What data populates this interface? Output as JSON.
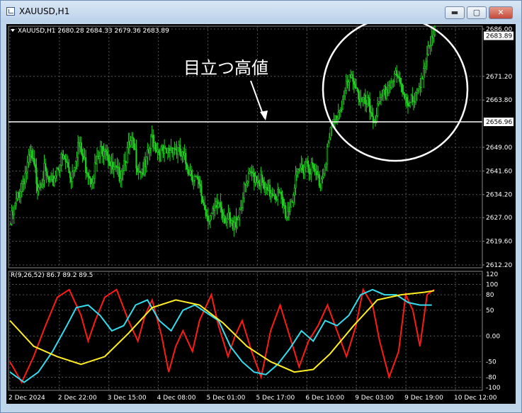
{
  "window": {
    "title": "XAUUSD,H1",
    "controls": {
      "minimize": "▬",
      "maximize": "▢",
      "close": "✕"
    },
    "colors": {
      "frame": "#bfd5ea",
      "chart_bg": "#000000",
      "candles": "#22cc22",
      "grid": "#555555",
      "axis_text": "#ffffff"
    }
  },
  "chart_data": [
    {
      "type": "candlestick",
      "symbol_info": "XAUUSD,H1  2680.28 2684.33 2679.36 2683.89",
      "annotation": "目立つ高値",
      "horizontal_line": {
        "value": 2656.96,
        "label": "2656.96",
        "color": "#ffffff"
      },
      "last_price": {
        "value": 2683.89,
        "label": "2683.89"
      },
      "y_ticks": [
        {
          "label": "2686.00",
          "value": 2686.0
        },
        {
          "label": "2671.20",
          "value": 2671.2
        },
        {
          "label": "2663.80",
          "value": 2663.8
        },
        {
          "label": "2649.00",
          "value": 2649.0
        },
        {
          "label": "2641.60",
          "value": 2641.6
        },
        {
          "label": "2634.20",
          "value": 2634.2
        },
        {
          "label": "2627.00",
          "value": 2627.0
        },
        {
          "label": "2619.60",
          "value": 2619.6
        },
        {
          "label": "2612.20",
          "value": 2612.2
        }
      ],
      "ylim": [
        2612.2,
        2686.0
      ],
      "x_ticks": [
        "2 Dec 2024",
        "2 Dec 22:00",
        "3 Dec 15:00",
        "4 Dec 08:00",
        "5 Dec 01:00",
        "5 Dec 17:00",
        "6 Dec 10:00",
        "9 Dec 03:00",
        "9 Dec 19:00",
        "10 Dec 12:00"
      ],
      "close_path": [
        [
          0,
          2625
        ],
        [
          6,
          2633
        ],
        [
          12,
          2640
        ],
        [
          18,
          2646
        ],
        [
          24,
          2638
        ],
        [
          30,
          2641
        ],
        [
          36,
          2636
        ],
        [
          42,
          2644
        ],
        [
          48,
          2645
        ],
        [
          54,
          2640
        ],
        [
          60,
          2650
        ],
        [
          66,
          2644
        ],
        [
          72,
          2640
        ],
        [
          78,
          2645
        ],
        [
          84,
          2651
        ],
        [
          90,
          2642
        ],
        [
          96,
          2640
        ],
        [
          102,
          2646
        ],
        [
          108,
          2650
        ],
        [
          114,
          2643
        ],
        [
          120,
          2642
        ],
        [
          126,
          2652
        ],
        [
          132,
          2648
        ],
        [
          138,
          2646
        ],
        [
          144,
          2650
        ],
        [
          150,
          2647
        ],
        [
          156,
          2644
        ],
        [
          162,
          2641
        ],
        [
          168,
          2636
        ],
        [
          174,
          2629
        ],
        [
          180,
          2627
        ],
        [
          186,
          2632
        ],
        [
          192,
          2627
        ],
        [
          198,
          2623
        ],
        [
          204,
          2630
        ],
        [
          210,
          2637
        ],
        [
          216,
          2641
        ],
        [
          222,
          2639
        ],
        [
          228,
          2634
        ],
        [
          234,
          2636
        ],
        [
          240,
          2633
        ],
        [
          246,
          2628
        ],
        [
          252,
          2635
        ],
        [
          258,
          2642
        ],
        [
          264,
          2645
        ],
        [
          270,
          2641
        ],
        [
          276,
          2638
        ],
        [
          282,
          2648
        ],
        [
          288,
          2657
        ],
        [
          294,
          2662
        ],
        [
          300,
          2668
        ],
        [
          306,
          2671
        ],
        [
          312,
          2663
        ],
        [
          318,
          2662
        ],
        [
          324,
          2658
        ],
        [
          330,
          2663
        ],
        [
          336,
          2668
        ],
        [
          342,
          2671
        ],
        [
          348,
          2668
        ],
        [
          354,
          2664
        ],
        [
          360,
          2662
        ],
        [
          366,
          2672
        ],
        [
          372,
          2678
        ],
        [
          378,
          2684
        ]
      ],
      "high_circle": {
        "x": 343,
        "y": 2666,
        "label": ""
      }
    },
    {
      "type": "line",
      "indicator_label": "R(9,26,52) 86.7 89.2 89.5",
      "ylim": [
        -100,
        120
      ],
      "y_ticks": [
        {
          "label": "120",
          "value": 120
        },
        {
          "label": "100",
          "value": 100
        },
        {
          "label": "80",
          "value": 80
        },
        {
          "label": "50",
          "value": 50
        },
        {
          "label": "0.00",
          "value": 0
        },
        {
          "label": "-50",
          "value": -50
        },
        {
          "label": "-80",
          "value": -80
        },
        {
          "label": "-100",
          "value": -100
        }
      ],
      "series": [
        {
          "color": "#ff1a1a",
          "points": [
            [
              0,
              -50
            ],
            [
              10,
              -90
            ],
            [
              20,
              -40
            ],
            [
              30,
              20
            ],
            [
              40,
              75
            ],
            [
              50,
              90
            ],
            [
              60,
              40
            ],
            [
              66,
              -10
            ],
            [
              72,
              30
            ],
            [
              80,
              75
            ],
            [
              90,
              90
            ],
            [
              100,
              30
            ],
            [
              108,
              -10
            ],
            [
              114,
              40
            ],
            [
              120,
              70
            ],
            [
              128,
              0
            ],
            [
              134,
              -70
            ],
            [
              140,
              -20
            ],
            [
              146,
              10
            ],
            [
              154,
              -30
            ],
            [
              160,
              30
            ],
            [
              170,
              80
            ],
            [
              176,
              20
            ],
            [
              184,
              -40
            ],
            [
              190,
              0
            ],
            [
              196,
              30
            ],
            [
              204,
              -30
            ],
            [
              212,
              -80
            ],
            [
              220,
              10
            ],
            [
              228,
              60
            ],
            [
              236,
              0
            ],
            [
              244,
              -60
            ],
            [
              252,
              -10
            ],
            [
              260,
              20
            ],
            [
              268,
              60
            ],
            [
              276,
              10
            ],
            [
              284,
              -40
            ],
            [
              292,
              20
            ],
            [
              298,
              90
            ],
            [
              306,
              60
            ],
            [
              312,
              -10
            ],
            [
              320,
              -80
            ],
            [
              328,
              -30
            ],
            [
              334,
              80
            ],
            [
              340,
              50
            ],
            [
              346,
              -20
            ],
            [
              352,
              80
            ],
            [
              358,
              90
            ]
          ]
        },
        {
          "color": "#33ddee",
          "points": [
            [
              0,
              -70
            ],
            [
              12,
              -90
            ],
            [
              24,
              -70
            ],
            [
              36,
              -30
            ],
            [
              48,
              20
            ],
            [
              56,
              55
            ],
            [
              66,
              60
            ],
            [
              76,
              40
            ],
            [
              86,
              10
            ],
            [
              96,
              20
            ],
            [
              106,
              60
            ],
            [
              116,
              70
            ],
            [
              126,
              30
            ],
            [
              136,
              10
            ],
            [
              146,
              50
            ],
            [
              156,
              60
            ],
            [
              166,
              45
            ],
            [
              176,
              30
            ],
            [
              186,
              -20
            ],
            [
              196,
              -50
            ],
            [
              206,
              -70
            ],
            [
              216,
              -75
            ],
            [
              226,
              -55
            ],
            [
              236,
              -25
            ],
            [
              246,
              10
            ],
            [
              256,
              -10
            ],
            [
              266,
              30
            ],
            [
              276,
              20
            ],
            [
              286,
              40
            ],
            [
              296,
              80
            ],
            [
              306,
              90
            ],
            [
              316,
              80
            ],
            [
              326,
              80
            ],
            [
              336,
              65
            ],
            [
              346,
              60
            ],
            [
              356,
              60
            ]
          ]
        },
        {
          "color": "#ffee22",
          "points": [
            [
              0,
              30
            ],
            [
              20,
              -20
            ],
            [
              40,
              -40
            ],
            [
              60,
              -55
            ],
            [
              80,
              -40
            ],
            [
              100,
              5
            ],
            [
              120,
              55
            ],
            [
              140,
              70
            ],
            [
              160,
              60
            ],
            [
              180,
              25
            ],
            [
              200,
              -20
            ],
            [
              220,
              -50
            ],
            [
              240,
              -70
            ],
            [
              256,
              -65
            ],
            [
              270,
              -35
            ],
            [
              290,
              20
            ],
            [
              310,
              70
            ],
            [
              330,
              80
            ],
            [
              350,
              85
            ],
            [
              358,
              88
            ]
          ]
        }
      ]
    }
  ]
}
